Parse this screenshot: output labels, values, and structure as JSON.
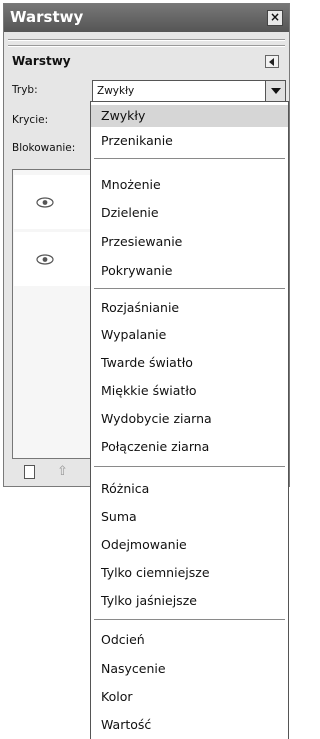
{
  "window": {
    "title": "Warstwy",
    "close_glyph": "×"
  },
  "dock": {
    "title": "Warstwy"
  },
  "labels": {
    "mode": "Tryb:",
    "opacity": "Krycie:",
    "lock": "Blokowanie:"
  },
  "mode_select": {
    "value": "Zwykły"
  },
  "dropdown": {
    "items": [
      "Zwykły",
      "Przenikanie",
      "Mnożenie",
      "Dzielenie",
      "Przesiewanie",
      "Pokrywanie",
      "Rozjaśnianie",
      "Wypalanie",
      "Twarde światło",
      "Miękkie światło",
      "Wydobycie ziarna",
      "Połączenie ziarna",
      "Różnica",
      "Suma",
      "Odejmowanie",
      "Tylko ciemniejsze",
      "Tylko jaśniejsze",
      "Odcień",
      "Nasycenie",
      "Kolor",
      "Wartość"
    ],
    "selected_index": 0
  },
  "icons": [
    "close-icon",
    "dock-menu-icon",
    "dropdown-arrow-icon",
    "eye-icon",
    "new-layer-icon",
    "raise-layer-icon"
  ]
}
